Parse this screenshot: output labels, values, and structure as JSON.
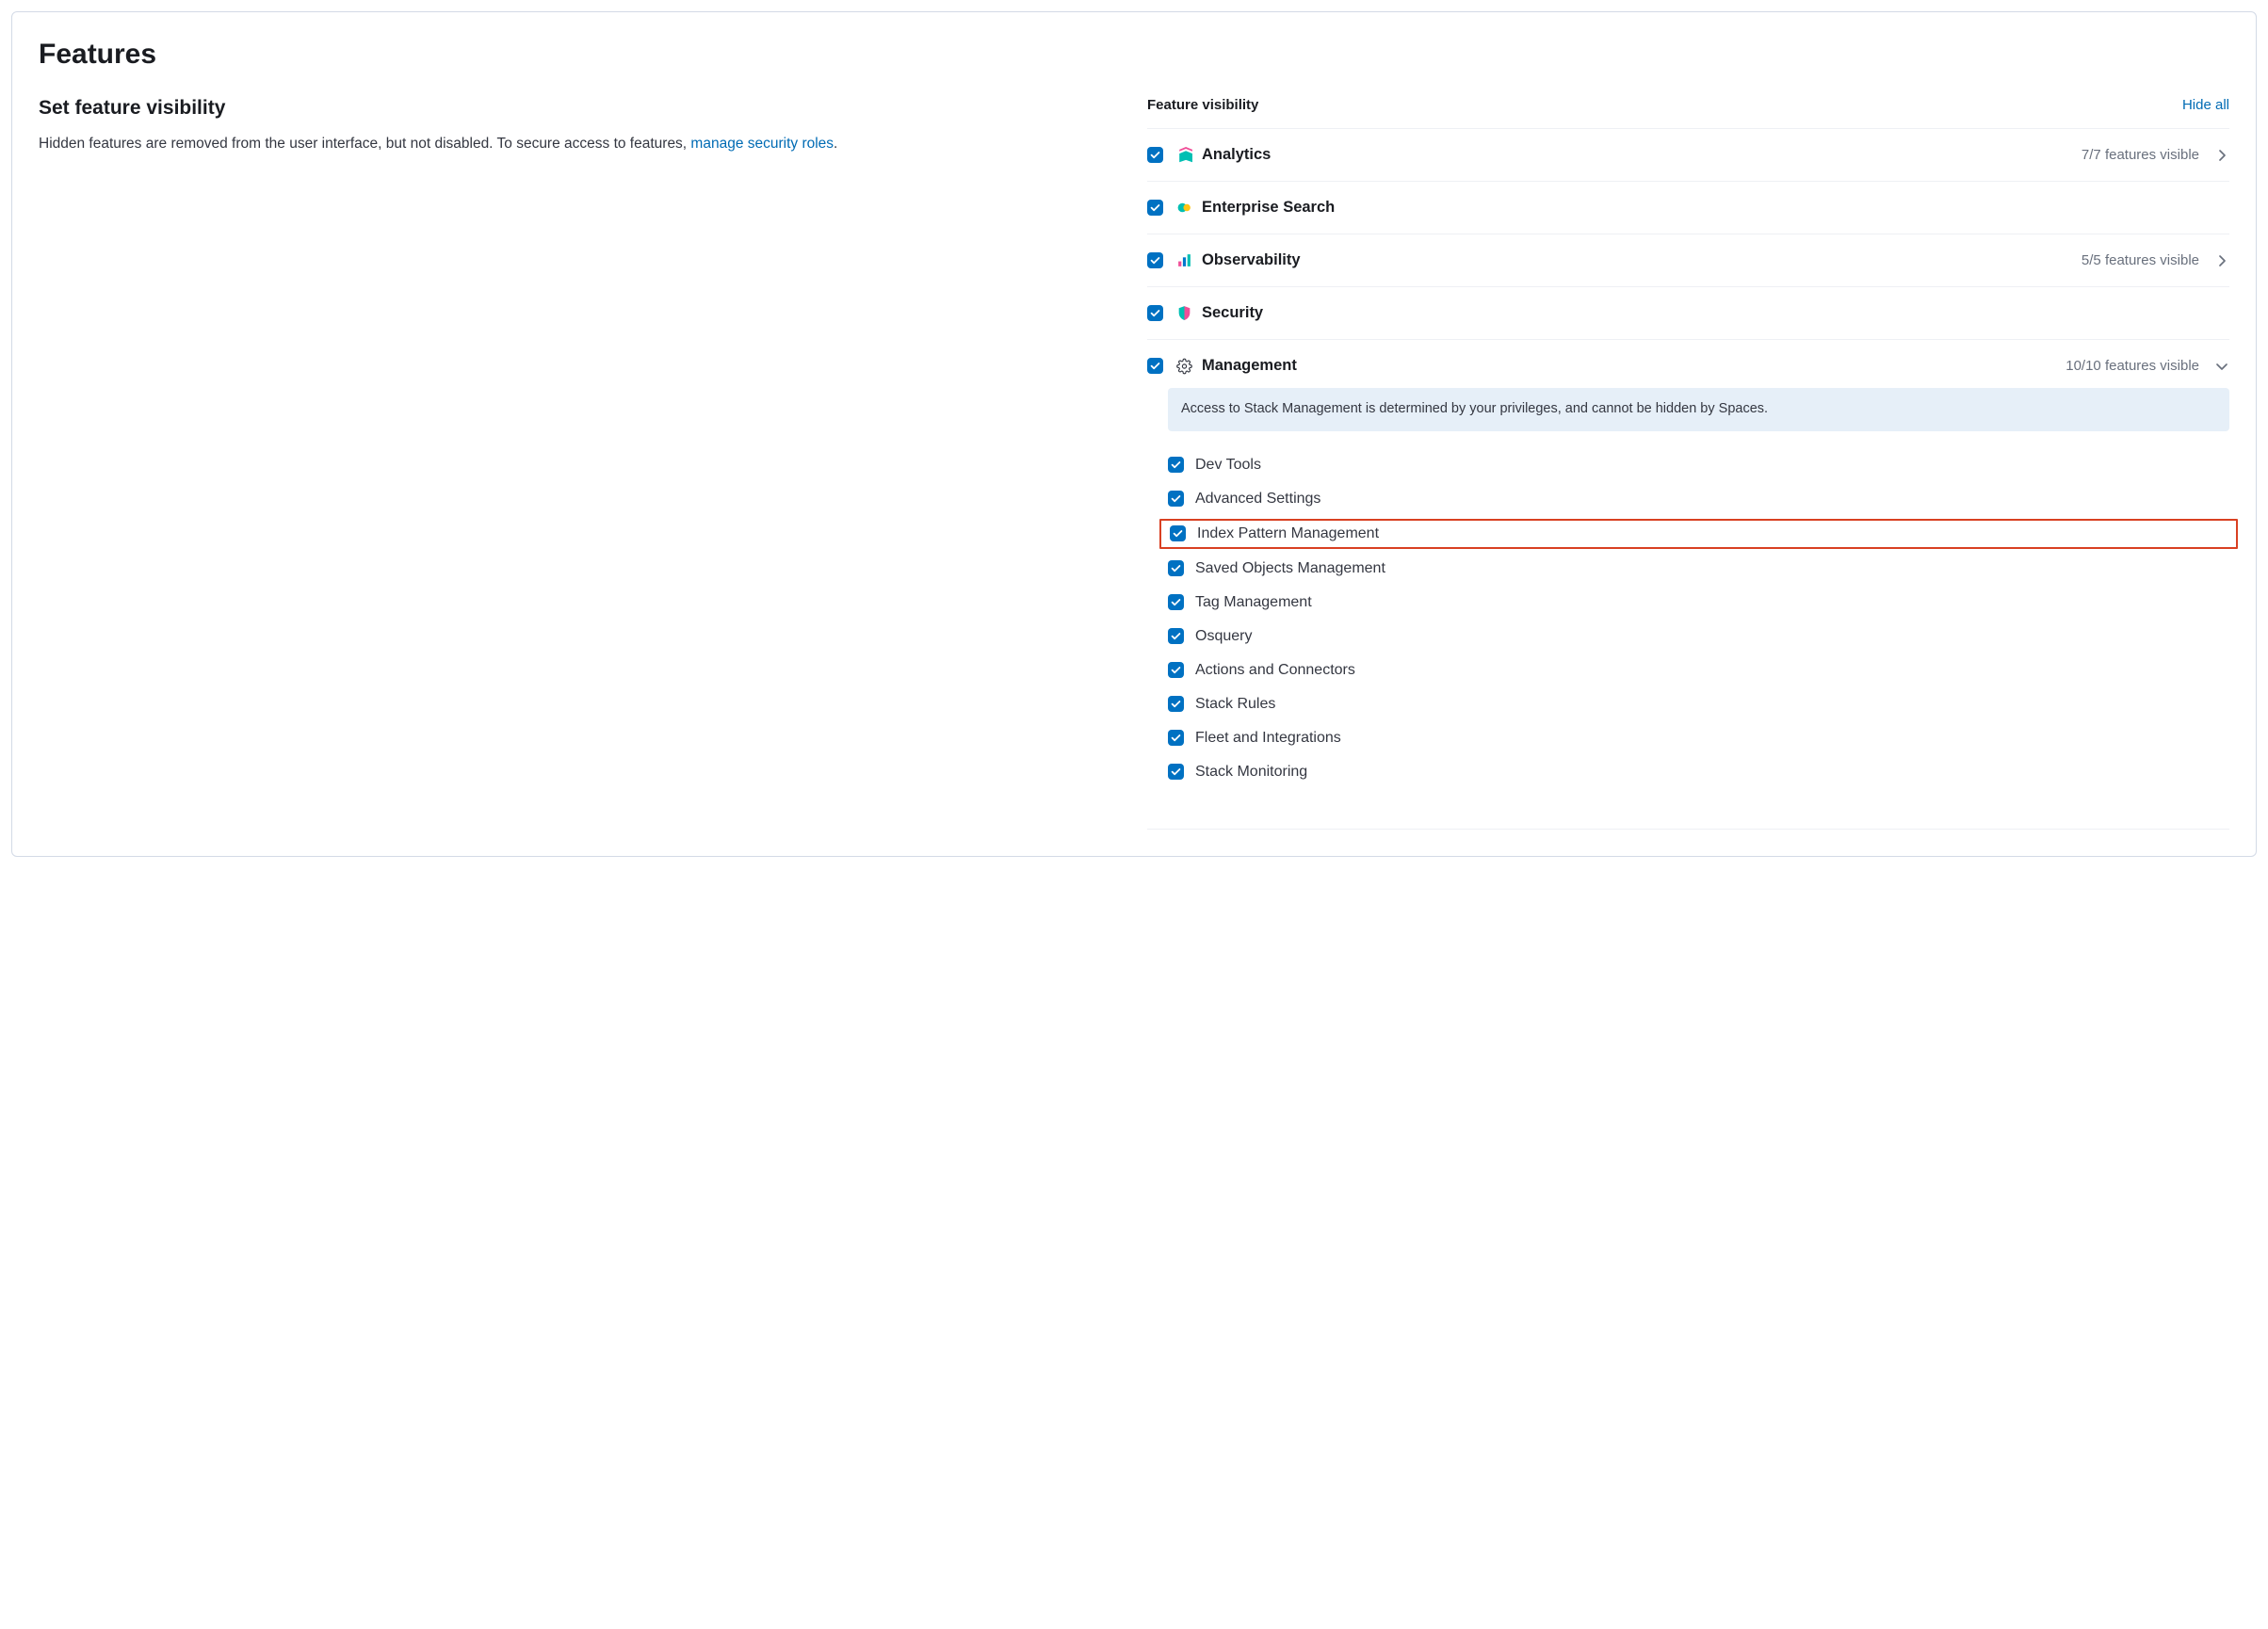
{
  "page_title": "Features",
  "left": {
    "subtitle": "Set feature visibility",
    "desc_before": "Hidden features are removed from the user interface, but not disabled. To secure access to features, ",
    "desc_link": "manage security roles",
    "desc_after": "."
  },
  "right": {
    "header_label": "Feature visibility",
    "hide_all_label": "Hide all",
    "categories": [
      {
        "id": "analytics",
        "label": "Analytics",
        "status": "7/7 features visible",
        "expandable": true,
        "expanded": false
      },
      {
        "id": "enterprise-search",
        "label": "Enterprise Search",
        "status": "",
        "expandable": false,
        "expanded": false
      },
      {
        "id": "observability",
        "label": "Observability",
        "status": "5/5 features visible",
        "expandable": true,
        "expanded": false
      },
      {
        "id": "security",
        "label": "Security",
        "status": "",
        "expandable": false,
        "expanded": false
      },
      {
        "id": "management",
        "label": "Management",
        "status": "10/10 features visible",
        "expandable": true,
        "expanded": true
      }
    ],
    "management_notice": "Access to Stack Management is determined by your privileges, and cannot be hidden by Spaces.",
    "management_items": [
      {
        "label": "Dev Tools",
        "highlighted": false
      },
      {
        "label": "Advanced Settings",
        "highlighted": false
      },
      {
        "label": "Index Pattern Management",
        "highlighted": true
      },
      {
        "label": "Saved Objects Management",
        "highlighted": false
      },
      {
        "label": "Tag Management",
        "highlighted": false
      },
      {
        "label": "Osquery",
        "highlighted": false
      },
      {
        "label": "Actions and Connectors",
        "highlighted": false
      },
      {
        "label": "Stack Rules",
        "highlighted": false
      },
      {
        "label": "Fleet and Integrations",
        "highlighted": false
      },
      {
        "label": "Stack Monitoring",
        "highlighted": false
      }
    ]
  }
}
